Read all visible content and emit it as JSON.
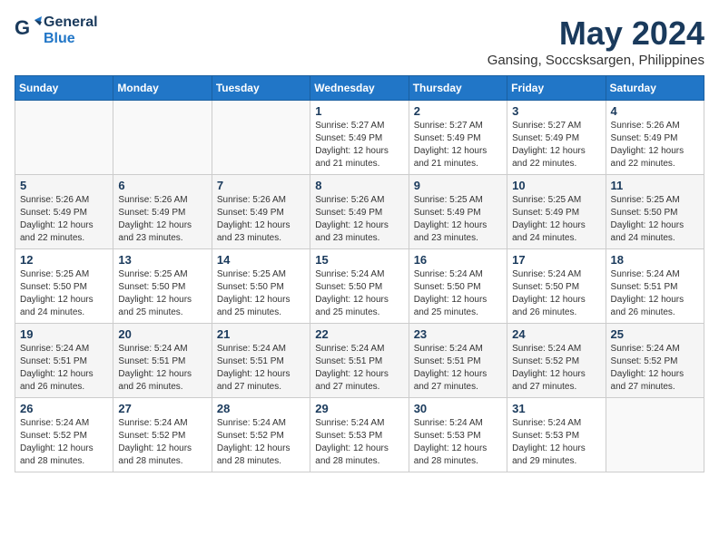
{
  "header": {
    "logo_general": "General",
    "logo_blue": "Blue",
    "month_title": "May 2024",
    "location": "Gansing, Soccsksargen, Philippines"
  },
  "days_of_week": [
    "Sunday",
    "Monday",
    "Tuesday",
    "Wednesday",
    "Thursday",
    "Friday",
    "Saturday"
  ],
  "weeks": [
    [
      {
        "day": "",
        "info": ""
      },
      {
        "day": "",
        "info": ""
      },
      {
        "day": "",
        "info": ""
      },
      {
        "day": "1",
        "info": "Sunrise: 5:27 AM\nSunset: 5:49 PM\nDaylight: 12 hours\nand 21 minutes."
      },
      {
        "day": "2",
        "info": "Sunrise: 5:27 AM\nSunset: 5:49 PM\nDaylight: 12 hours\nand 21 minutes."
      },
      {
        "day": "3",
        "info": "Sunrise: 5:27 AM\nSunset: 5:49 PM\nDaylight: 12 hours\nand 22 minutes."
      },
      {
        "day": "4",
        "info": "Sunrise: 5:26 AM\nSunset: 5:49 PM\nDaylight: 12 hours\nand 22 minutes."
      }
    ],
    [
      {
        "day": "5",
        "info": "Sunrise: 5:26 AM\nSunset: 5:49 PM\nDaylight: 12 hours\nand 22 minutes."
      },
      {
        "day": "6",
        "info": "Sunrise: 5:26 AM\nSunset: 5:49 PM\nDaylight: 12 hours\nand 23 minutes."
      },
      {
        "day": "7",
        "info": "Sunrise: 5:26 AM\nSunset: 5:49 PM\nDaylight: 12 hours\nand 23 minutes."
      },
      {
        "day": "8",
        "info": "Sunrise: 5:26 AM\nSunset: 5:49 PM\nDaylight: 12 hours\nand 23 minutes."
      },
      {
        "day": "9",
        "info": "Sunrise: 5:25 AM\nSunset: 5:49 PM\nDaylight: 12 hours\nand 23 minutes."
      },
      {
        "day": "10",
        "info": "Sunrise: 5:25 AM\nSunset: 5:49 PM\nDaylight: 12 hours\nand 24 minutes."
      },
      {
        "day": "11",
        "info": "Sunrise: 5:25 AM\nSunset: 5:50 PM\nDaylight: 12 hours\nand 24 minutes."
      }
    ],
    [
      {
        "day": "12",
        "info": "Sunrise: 5:25 AM\nSunset: 5:50 PM\nDaylight: 12 hours\nand 24 minutes."
      },
      {
        "day": "13",
        "info": "Sunrise: 5:25 AM\nSunset: 5:50 PM\nDaylight: 12 hours\nand 25 minutes."
      },
      {
        "day": "14",
        "info": "Sunrise: 5:25 AM\nSunset: 5:50 PM\nDaylight: 12 hours\nand 25 minutes."
      },
      {
        "day": "15",
        "info": "Sunrise: 5:24 AM\nSunset: 5:50 PM\nDaylight: 12 hours\nand 25 minutes."
      },
      {
        "day": "16",
        "info": "Sunrise: 5:24 AM\nSunset: 5:50 PM\nDaylight: 12 hours\nand 25 minutes."
      },
      {
        "day": "17",
        "info": "Sunrise: 5:24 AM\nSunset: 5:50 PM\nDaylight: 12 hours\nand 26 minutes."
      },
      {
        "day": "18",
        "info": "Sunrise: 5:24 AM\nSunset: 5:51 PM\nDaylight: 12 hours\nand 26 minutes."
      }
    ],
    [
      {
        "day": "19",
        "info": "Sunrise: 5:24 AM\nSunset: 5:51 PM\nDaylight: 12 hours\nand 26 minutes."
      },
      {
        "day": "20",
        "info": "Sunrise: 5:24 AM\nSunset: 5:51 PM\nDaylight: 12 hours\nand 26 minutes."
      },
      {
        "day": "21",
        "info": "Sunrise: 5:24 AM\nSunset: 5:51 PM\nDaylight: 12 hours\nand 27 minutes."
      },
      {
        "day": "22",
        "info": "Sunrise: 5:24 AM\nSunset: 5:51 PM\nDaylight: 12 hours\nand 27 minutes."
      },
      {
        "day": "23",
        "info": "Sunrise: 5:24 AM\nSunset: 5:51 PM\nDaylight: 12 hours\nand 27 minutes."
      },
      {
        "day": "24",
        "info": "Sunrise: 5:24 AM\nSunset: 5:52 PM\nDaylight: 12 hours\nand 27 minutes."
      },
      {
        "day": "25",
        "info": "Sunrise: 5:24 AM\nSunset: 5:52 PM\nDaylight: 12 hours\nand 27 minutes."
      }
    ],
    [
      {
        "day": "26",
        "info": "Sunrise: 5:24 AM\nSunset: 5:52 PM\nDaylight: 12 hours\nand 28 minutes."
      },
      {
        "day": "27",
        "info": "Sunrise: 5:24 AM\nSunset: 5:52 PM\nDaylight: 12 hours\nand 28 minutes."
      },
      {
        "day": "28",
        "info": "Sunrise: 5:24 AM\nSunset: 5:52 PM\nDaylight: 12 hours\nand 28 minutes."
      },
      {
        "day": "29",
        "info": "Sunrise: 5:24 AM\nSunset: 5:53 PM\nDaylight: 12 hours\nand 28 minutes."
      },
      {
        "day": "30",
        "info": "Sunrise: 5:24 AM\nSunset: 5:53 PM\nDaylight: 12 hours\nand 28 minutes."
      },
      {
        "day": "31",
        "info": "Sunrise: 5:24 AM\nSunset: 5:53 PM\nDaylight: 12 hours\nand 29 minutes."
      },
      {
        "day": "",
        "info": ""
      }
    ]
  ]
}
